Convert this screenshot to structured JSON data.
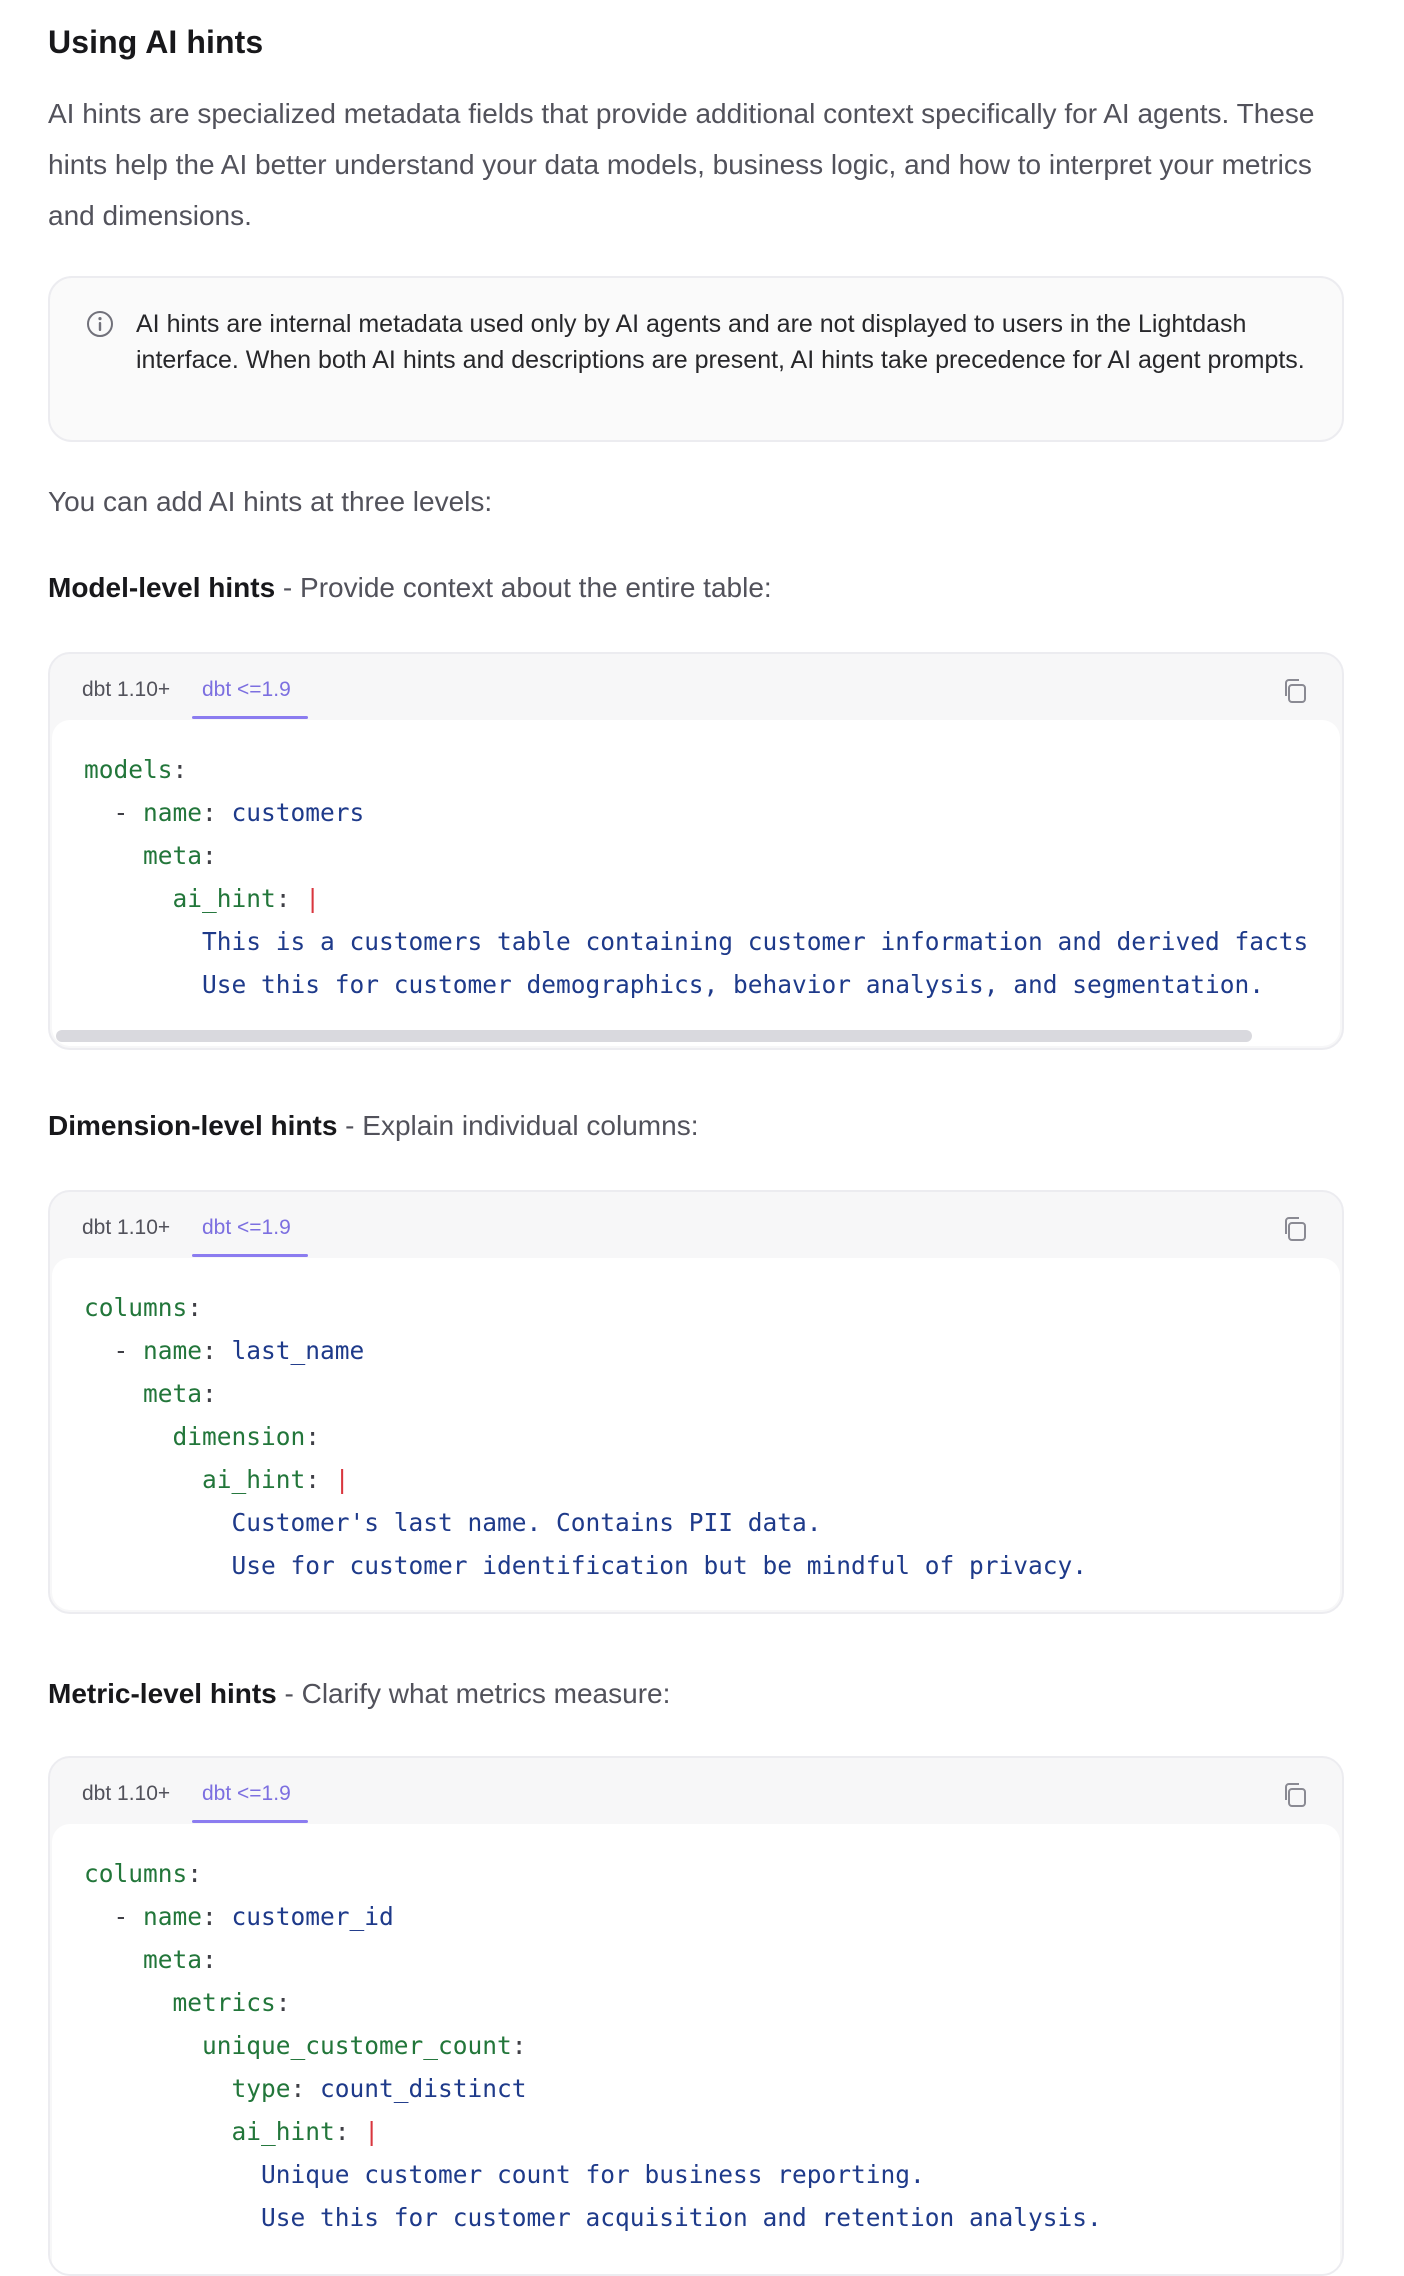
{
  "heading": "Using AI hints",
  "intro": "AI hints are specialized metadata fields that provide additional context specifically for AI agents. These hints help the AI better understand your data models, business logic, and how to interpret your metrics and dimensions.",
  "callout": {
    "icon": "info-icon",
    "text": "AI hints are internal metadata used only by AI agents and are not displayed to users in the Lightdash interface. When both AI hints and descriptions are present, AI hints take precedence for AI agent prompts."
  },
  "levels_text": "You can add AI hints at three levels:",
  "sections": [
    {
      "bold": "Model-level hints",
      "rest": " - Provide context about the entire table:",
      "tabs": [
        "dbt 1.10+",
        "dbt <=1.9"
      ],
      "code": [
        [
          "models:",
          "",
          ""
        ],
        [
          "  - name:",
          " customers",
          ""
        ],
        [
          "    meta:",
          "",
          ""
        ],
        [
          "      ai_hint:",
          "",
          " |"
        ],
        [
          "        ",
          "This is a customers table containing customer information and derived facts",
          ""
        ],
        [
          "        ",
          "Use this for customer demographics, behavior analysis, and segmentation.",
          ""
        ]
      ]
    },
    {
      "bold": "Dimension-level hints",
      "rest": " - Explain individual columns:",
      "tabs": [
        "dbt 1.10+",
        "dbt <=1.9"
      ],
      "code": [
        [
          "columns:",
          "",
          ""
        ],
        [
          "  - name:",
          " last_name",
          ""
        ],
        [
          "    meta:",
          "",
          ""
        ],
        [
          "      dimension:",
          "",
          ""
        ],
        [
          "        ai_hint:",
          "",
          " |"
        ],
        [
          "          ",
          "Customer's last name. Contains PII data.",
          ""
        ],
        [
          "          ",
          "Use for customer identification but be mindful of privacy.",
          ""
        ]
      ]
    },
    {
      "bold": "Metric-level hints",
      "rest": " - Clarify what metrics measure:",
      "tabs": [
        "dbt 1.10+",
        "dbt <=1.9"
      ],
      "code": [
        [
          "columns:",
          "",
          ""
        ],
        [
          "  - name:",
          " customer_id",
          ""
        ],
        [
          "    meta:",
          "",
          ""
        ],
        [
          "      metrics:",
          "",
          ""
        ],
        [
          "        unique_customer_count:",
          "",
          ""
        ],
        [
          "          type:",
          " count_distinct",
          ""
        ],
        [
          "          ai_hint:",
          "",
          " |"
        ],
        [
          "            ",
          "Unique customer count for business reporting.",
          ""
        ],
        [
          "            ",
          "Use this for customer acquisition and retention analysis.",
          ""
        ]
      ]
    }
  ],
  "colors": {
    "key": "#22763a",
    "value": "#1e3a8a",
    "pipe": "#d9363e",
    "active_tab": "#7c6fe0"
  }
}
